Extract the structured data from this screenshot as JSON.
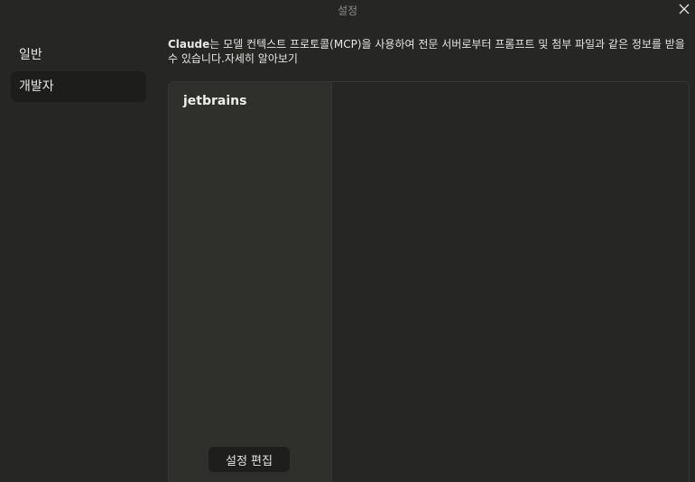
{
  "window": {
    "title": "설정",
    "close_icon": "close-icon"
  },
  "sidebar": {
    "items": [
      {
        "label": "일반",
        "active": false
      },
      {
        "label": "개발자",
        "active": true
      }
    ]
  },
  "description": {
    "brand": "Claude",
    "text": "는 모델 컨텍스트 프로토콜(MCP)을 사용하여 전문 서버로부터 프롬프트 및 첨부 파일과 같은 정보를 받을 수 있습니다.",
    "learn_more": "자세히 알아보기"
  },
  "servers": {
    "items": [
      {
        "name": "jetbrains"
      }
    ],
    "edit_config_label": "설정 편집"
  },
  "colors": {
    "background": "#262624",
    "sidebar_active": "#1d1d1b",
    "server_list_bg": "#2f2f2b",
    "border": "#353531",
    "text": "#e8e6e0"
  }
}
